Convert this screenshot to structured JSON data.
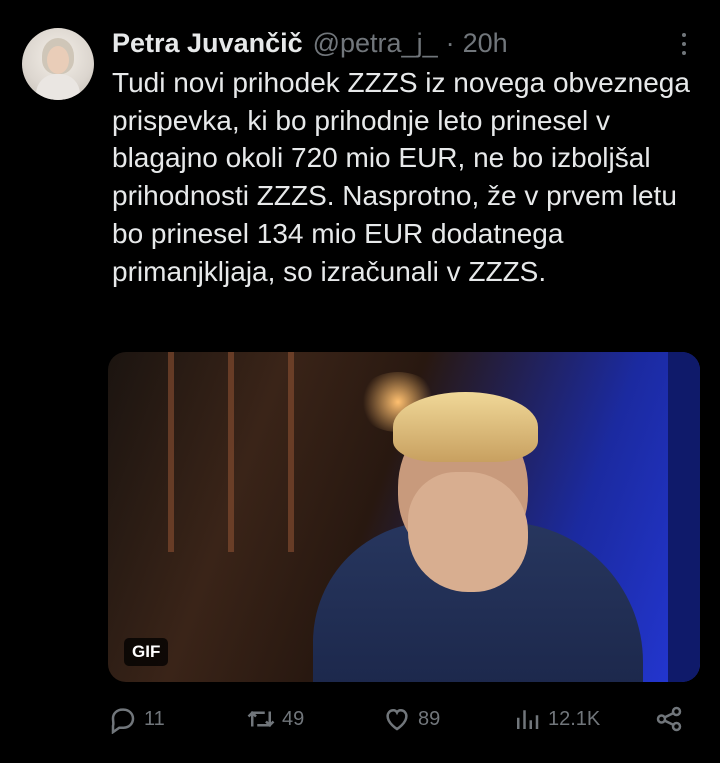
{
  "author": {
    "display_name": "Petra Juvančič",
    "handle": "@petra_j_",
    "separator": "·",
    "time": "20h"
  },
  "tweet": {
    "text": "Tudi novi prihodek ZZZS iz novega obveznega prispevka, ki bo prihodnje leto prinesel v blagajno okoli 720 mio EUR, ne bo izboljšal prihodnosti ZZZS. Nasprotno, že v prvem letu bo prinesel 134 mio EUR dodatnega primanjkljaja, so izračunali v ZZZS."
  },
  "media": {
    "badge": "GIF"
  },
  "actions": {
    "reply_count": "11",
    "retweet_count": "49",
    "like_count": "89",
    "views_count": "12.1K"
  },
  "colors": {
    "background": "#000000",
    "text": "#e7e9ea",
    "secondary": "#71767b"
  },
  "icons": [
    "more-icon",
    "reply-icon",
    "retweet-icon",
    "like-icon",
    "views-icon",
    "share-icon"
  ]
}
